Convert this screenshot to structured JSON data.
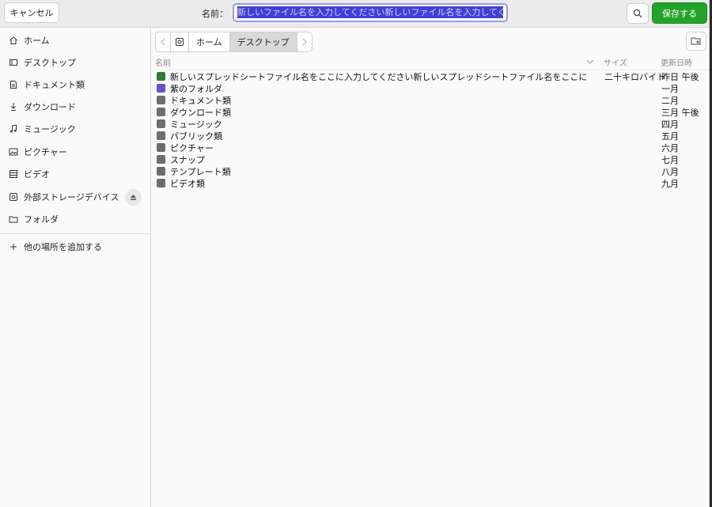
{
  "header": {
    "cancel_label": "キャンセル",
    "name_label": "名前：",
    "name_value": "新しいファイル名を入力してください新しいファイル名を入力してください新しいファイル名を入力してください",
    "save_label": "保存する"
  },
  "sidebar": {
    "items": [
      {
        "label": "ホーム",
        "icon": "home-icon"
      },
      {
        "label": "デスクトップ",
        "icon": "desktop-icon"
      },
      {
        "label": "ドキュメント類",
        "icon": "document-icon"
      },
      {
        "label": "ダウンロード",
        "icon": "download-icon"
      },
      {
        "label": "ミュージック",
        "icon": "music-icon"
      },
      {
        "label": "ピクチャー",
        "icon": "picture-icon"
      },
      {
        "label": "ビデオ",
        "icon": "video-icon"
      },
      {
        "label": "外部ストレージデバイス",
        "icon": "drive-icon"
      },
      {
        "label": "フォルダ",
        "icon": "folder-icon"
      }
    ],
    "add_label": "他の場所を追加する"
  },
  "breadcrumb": {
    "segments": [
      "ホーム",
      "デスクトップ"
    ]
  },
  "columns": {
    "name": "名前",
    "size": "サイズ",
    "modified": "更新日時"
  },
  "files": [
    {
      "name": "新しいスプレッドシートファイル名をここに入力してください新しいスプレッドシートファイル名をここに",
      "size": "二十キロバイト",
      "modified": "昨日 午後",
      "color": "#2e7d32"
    },
    {
      "name": "紫のフォルダ",
      "size": "",
      "modified": "一月",
      "color": "#6a4fc9"
    },
    {
      "name": "ドキュメント類",
      "size": "",
      "modified": "二月",
      "color": "#6d6d6d"
    },
    {
      "name": "ダウンロード類",
      "size": "",
      "modified": "三月 午後",
      "color": "#6d6d6d"
    },
    {
      "name": "ミュージック",
      "size": "",
      "modified": "四月",
      "color": "#6d6d6d"
    },
    {
      "name": "パブリック類",
      "size": "",
      "modified": "五月",
      "color": "#6d6d6d"
    },
    {
      "name": "ピクチャー",
      "size": "",
      "modified": "六月",
      "color": "#6d6d6d"
    },
    {
      "name": "スナップ",
      "size": "",
      "modified": "七月",
      "color": "#6d6d6d"
    },
    {
      "name": "テンプレート類",
      "size": "",
      "modified": "八月",
      "color": "#6d6d6d"
    },
    {
      "name": "ビデオ類",
      "size": "",
      "modified": "九月",
      "color": "#6d6d6d"
    }
  ]
}
